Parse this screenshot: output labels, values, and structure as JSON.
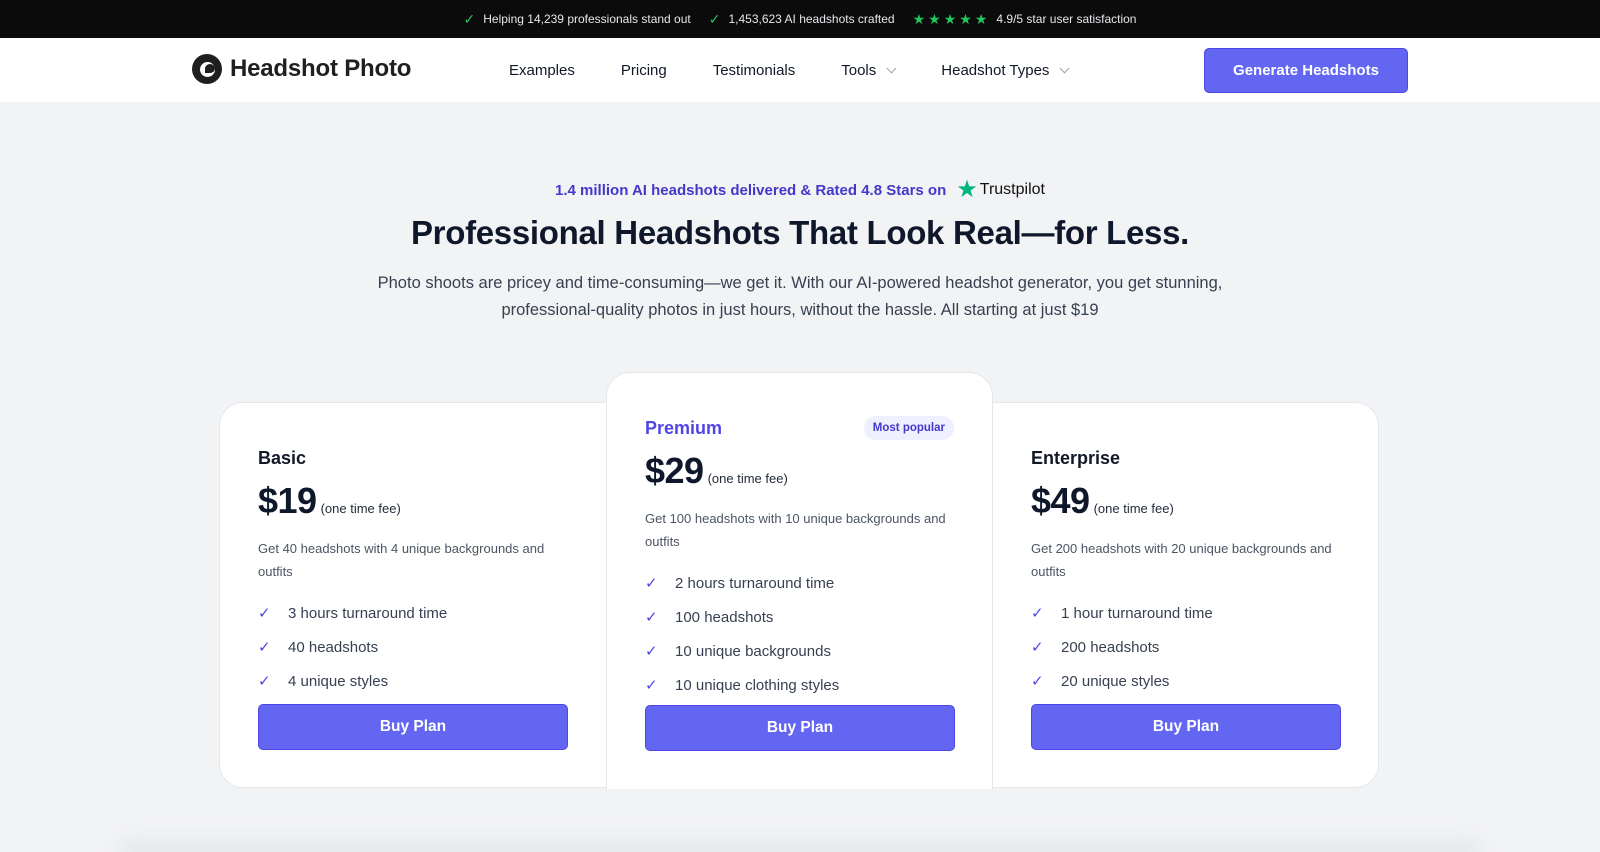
{
  "topbar": {
    "stats": [
      {
        "icon": "check-icon",
        "text": "Helping 14,239 professionals stand out"
      },
      {
        "icon": "check-icon",
        "text": "1,453,623 AI headshots crafted"
      },
      {
        "icon": "stars-icon",
        "text": "4.9/5 star user satisfaction",
        "stars": 5
      }
    ]
  },
  "header": {
    "brand": "Headshot Photo",
    "nav": [
      {
        "label": "Examples",
        "dropdown": false
      },
      {
        "label": "Pricing",
        "dropdown": false
      },
      {
        "label": "Testimonials",
        "dropdown": false
      },
      {
        "label": "Tools",
        "dropdown": true
      },
      {
        "label": "Headshot Types",
        "dropdown": true
      }
    ],
    "cta_label": "Generate Headshots"
  },
  "hero": {
    "tagline": "1.4 million AI headshots delivered & Rated 4.8 Stars on",
    "trustpilot": "Trustpilot",
    "headline": "Professional Headshots That Look Real—for Less.",
    "subtext": "Photo shoots are pricey and time-consuming—we get it. With our AI-powered headshot generator, you get stunning, professional-quality photos in just hours, without the hassle. All starting at just $19"
  },
  "plans": [
    {
      "name": "Basic",
      "price": "$19",
      "fee": "(one time fee)",
      "description": "Get 40 headshots with 4 unique backgrounds and outfits",
      "features": [
        "3 hours turnaround time",
        "40 headshots",
        "4 unique styles"
      ],
      "button": "Buy Plan"
    },
    {
      "name": "Premium",
      "badge": "Most popular",
      "price": "$29",
      "fee": "(one time fee)",
      "description": "Get 100 headshots with 10 unique backgrounds and outfits",
      "features": [
        "2 hours turnaround time",
        "100 headshots",
        "10 unique backgrounds",
        "10 unique clothing styles"
      ],
      "button": "Buy Plan"
    },
    {
      "name": "Enterprise",
      "price": "$49",
      "fee": "(one time fee)",
      "description": "Get 200 headshots with 20 unique backgrounds and outfits",
      "features": [
        "1 hour turnaround time",
        "200 headshots",
        "20 unique styles"
      ],
      "button": "Buy Plan"
    }
  ],
  "colors": {
    "accent": "#6366f1",
    "accent_text": "#4338ca",
    "success": "#22c55e",
    "trustpilot": "#00b67a"
  }
}
